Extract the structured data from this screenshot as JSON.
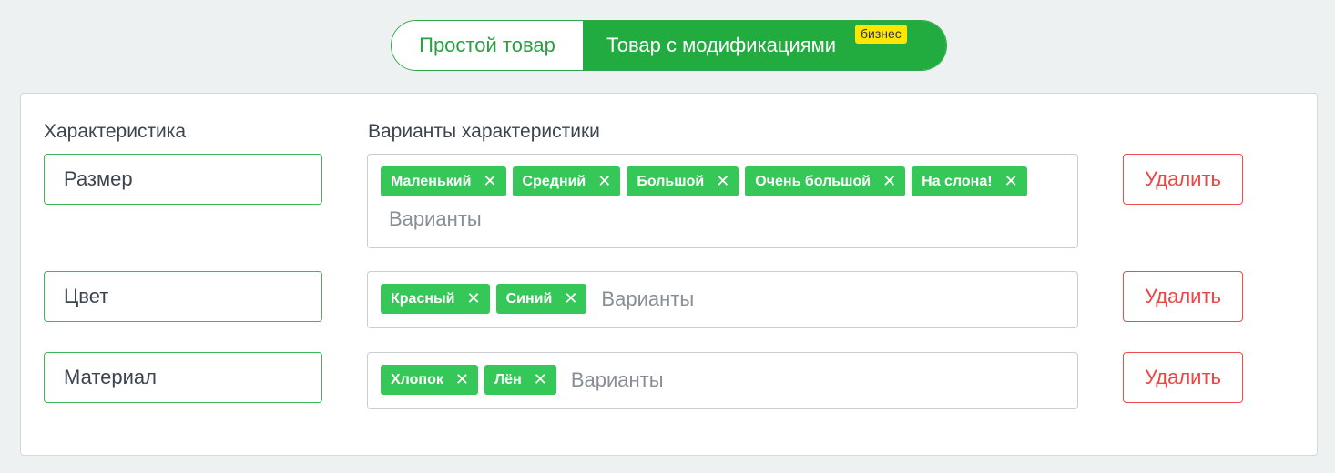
{
  "product_type_toggle": {
    "simple_label": "Простой товар",
    "modifications_label": "Товар с модификациями",
    "badge": "бизнес",
    "active": "modifications"
  },
  "columns": {
    "characteristic_label": "Характеристика",
    "variants_label": "Варианты характеристики"
  },
  "rows": [
    {
      "name": "Размер",
      "variants": [
        "Маленький",
        "Средний",
        "Большой",
        "Очень большой",
        "На слона!"
      ],
      "variants_placeholder": "Варианты",
      "delete_label": "Удалить"
    },
    {
      "name": "Цвет",
      "variants": [
        "Красный",
        "Синий"
      ],
      "variants_placeholder": "Варианты",
      "delete_label": "Удалить"
    },
    {
      "name": "Материал",
      "variants": [
        "Хлопок",
        "Лён"
      ],
      "variants_placeholder": "Варианты",
      "delete_label": "Удалить"
    }
  ],
  "icons": {
    "tag_remove": "close-icon",
    "tag_remove_glyph": "✕"
  },
  "colors": {
    "accent_green": "#22ab3f",
    "tag_green": "#35c757",
    "badge_yellow": "#ffe600",
    "delete_red": "#ee4444"
  }
}
